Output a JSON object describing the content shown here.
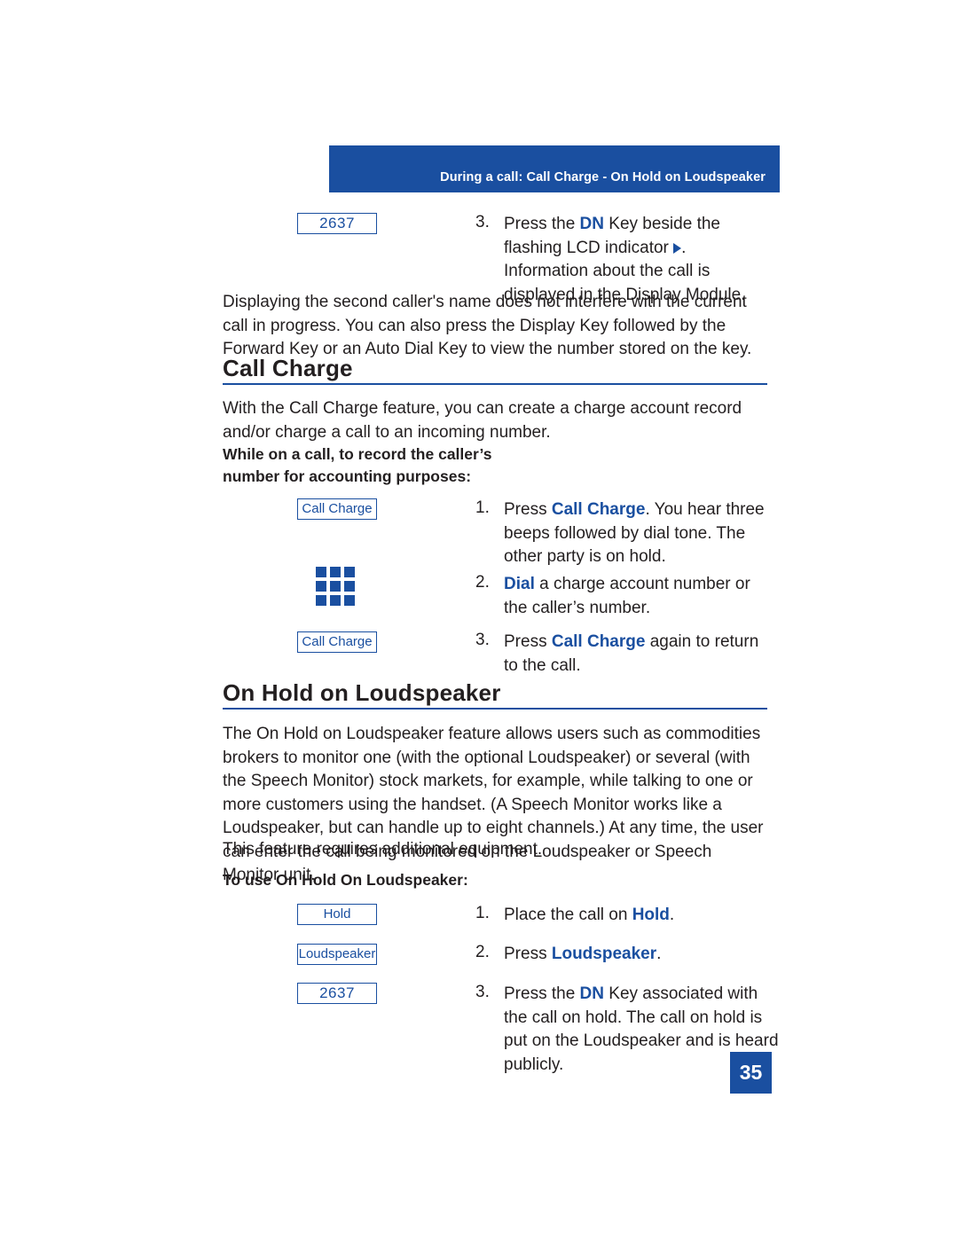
{
  "header": {
    "banner_text": "During a call: Call Charge - On Hold on Loudspeaker"
  },
  "intro_step": {
    "key_label": "2637",
    "number": "3.",
    "text_1": "Press the ",
    "dn": "DN",
    "text_2": " Key beside the flashing LCD indicator ",
    "text_3": ". Information about the call is displayed in the Display Module."
  },
  "note_paragraph": "Displaying the second caller's name does not interfere with the current call in progress. You can also press the Display Key followed by the Forward Key or an Auto Dial Key to view the number stored on the key.",
  "call_charge": {
    "heading": "Call Charge",
    "description": "With the Call Charge feature, you can create a charge account record and/or charge a call to an incoming number.",
    "lead_in_line1": "While on a call, to record the caller’s",
    "lead_in_line2": "number for accounting purposes:",
    "steps": [
      {
        "key_label": "Call Charge",
        "number": "1.",
        "pre": "Press ",
        "emphasis": "Call Charge",
        "post": ". You hear three beeps followed by dial tone. The other party is on hold."
      },
      {
        "key_label": "keypad-icon",
        "number": "2.",
        "pre": "",
        "emphasis": "Dial",
        "post": " a charge account number or the caller’s number."
      },
      {
        "key_label": "Call Charge",
        "number": "3.",
        "pre": "Press ",
        "emphasis": "Call Charge",
        "post": " again to return to the call."
      }
    ]
  },
  "on_hold": {
    "heading": "On Hold on Loudspeaker",
    "paragraph": "The On Hold on Loudspeaker feature allows users such as commodities brokers to monitor one (with the optional Loudspeaker) or several (with the Speech Monitor) stock markets, for example, while talking to one or more customers using the handset. (A Speech Monitor works like a Loudspeaker, but can handle up to eight channels.) At any time, the user can enter the call being monitored on the Loudspeaker or Speech Monitor unit.",
    "equipment_note": "This feature requires additional equipment.",
    "lead_in": "To use On Hold On Loudspeaker:",
    "steps": [
      {
        "key_label": "Hold",
        "number": "1.",
        "pre": "Place the call on ",
        "emphasis": "Hold",
        "post": "."
      },
      {
        "key_label": "Loudspeaker",
        "number": "2.",
        "pre": "Press ",
        "emphasis": "Loudspeaker",
        "post": "."
      },
      {
        "key_label": "2637",
        "number": "3.",
        "pre": "Press the ",
        "emphasis": "DN",
        "post": " Key associated with the call on hold. The call on hold is put on the Loudspeaker and is heard publicly."
      }
    ]
  },
  "footer": {
    "page_number": "35"
  }
}
